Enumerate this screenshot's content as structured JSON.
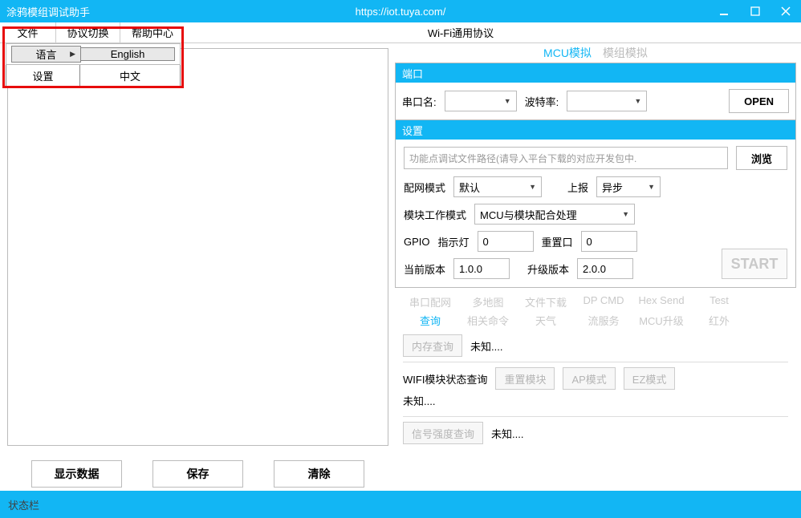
{
  "titlebar": {
    "app_title": "涂鸦模组调试助手",
    "url": "https://iot.tuya.com/"
  },
  "menubar": {
    "file": "文件",
    "protocol_switch": "协议切换",
    "help_center": "帮助中心",
    "protocol_title": "Wi-Fi通用协议"
  },
  "submenu": {
    "language": "语言",
    "settings": "设置",
    "english": "English",
    "chinese": "中文"
  },
  "tabs": {
    "mcu": "MCU模拟",
    "module": "模组模拟"
  },
  "port": {
    "header": "端口",
    "serial_label": "串口名:",
    "baud_label": "波特率:",
    "open": "OPEN"
  },
  "settings_panel": {
    "header": "设置",
    "path_placeholder": "功能点调试文件路径(请导入平台下载的对应开发包中.",
    "browse": "浏览",
    "netmode_label": "配网模式",
    "netmode_value": "默认",
    "report_label": "上报",
    "report_value": "异步",
    "workmode_label": "模块工作模式",
    "workmode_value": "MCU与模块配合处理",
    "gpio": "GPIO",
    "indicator": "指示灯",
    "indicator_val": "0",
    "reset": "重置口",
    "reset_val": "0",
    "cur_ver_label": "当前版本",
    "cur_ver_val": "1.0.0",
    "up_ver_label": "升级版本",
    "up_ver_val": "2.0.0",
    "start": "START"
  },
  "subtabs": {
    "r1": [
      "串口配网",
      "多地图",
      "文件下载",
      "DP CMD",
      "Hex Send",
      "Test"
    ],
    "r2": [
      "查询",
      "相关命令",
      "天气",
      "流服务",
      "MCU升级",
      "红外"
    ]
  },
  "query": {
    "mem_btn": "内存查询",
    "unknown": "未知....",
    "wifi_status_label": "WIFI模块状态查询",
    "reset_module": "重置模块",
    "ap_mode": "AP模式",
    "ez_mode": "EZ模式",
    "signal_btn": "信号强度查询"
  },
  "left_buttons": {
    "show": "显示数据",
    "save": "保存",
    "clear": "清除"
  },
  "statusbar": "状态栏"
}
